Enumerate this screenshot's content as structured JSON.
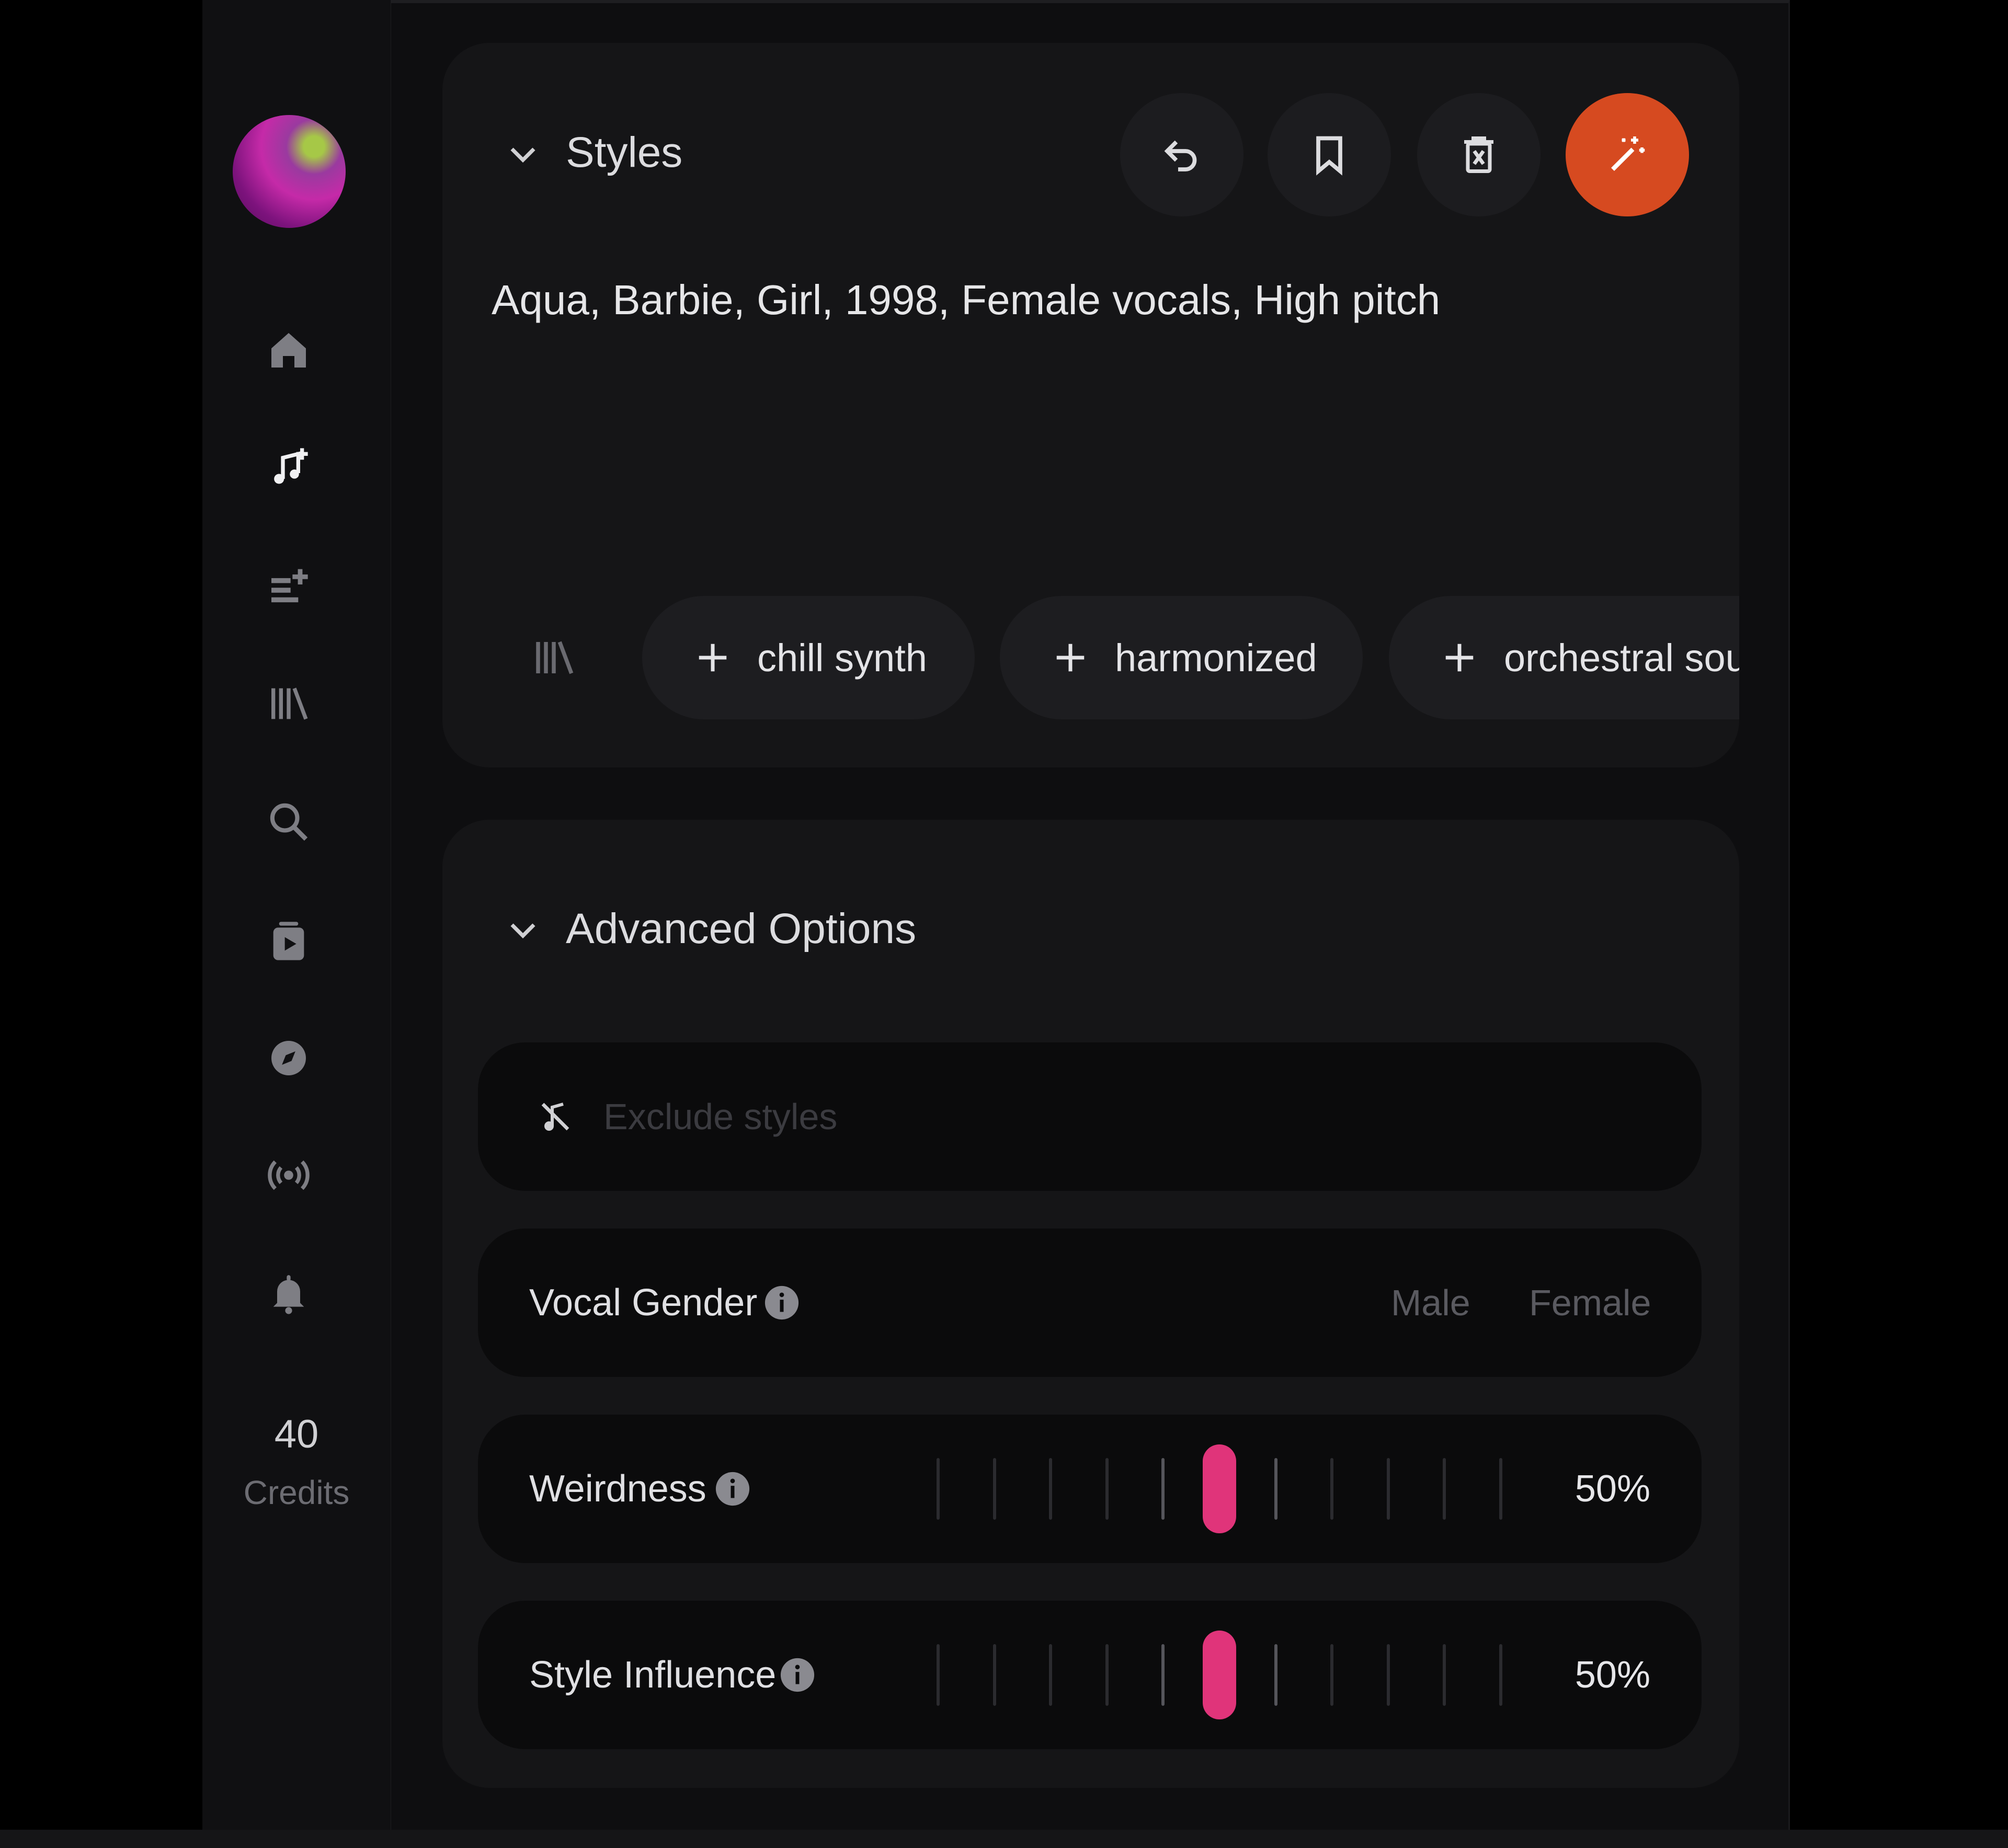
{
  "sidebar": {
    "nav": [
      {
        "icon": "home-icon"
      },
      {
        "icon": "create-music-icon"
      },
      {
        "icon": "playlist-add-icon"
      },
      {
        "icon": "library-icon"
      },
      {
        "icon": "search-icon"
      },
      {
        "icon": "video-icon"
      },
      {
        "icon": "explore-compass-icon"
      },
      {
        "icon": "radio-broadcast-icon"
      },
      {
        "icon": "bell-icon"
      }
    ],
    "credits_count": "40",
    "credits_label": "Credits"
  },
  "styles_section": {
    "title": "Styles",
    "text": "Aqua, Barbie, Girl, 1998, Female vocals, High pitch",
    "toolbar": [
      "undo-icon",
      "bookmark-icon",
      "clear-icon",
      "magic-wand-icon"
    ],
    "accent_color": "#d64a20",
    "tags": [
      "chill synth",
      "harmonized",
      "orchestral sou"
    ]
  },
  "advanced": {
    "title": "Advanced Options",
    "exclude_placeholder": "Exclude styles",
    "vocal_gender": {
      "label": "Vocal Gender",
      "options": [
        "Male",
        "Female"
      ]
    },
    "weirdness": {
      "label": "Weirdness",
      "value": "50%",
      "level": 0.5
    },
    "style_influence": {
      "label": "Style Influence",
      "value": "50%",
      "level": 0.5
    },
    "slider_color": "#e0347a"
  }
}
